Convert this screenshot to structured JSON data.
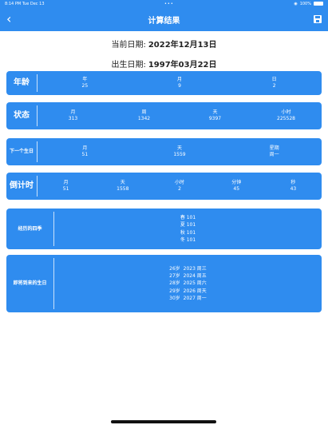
{
  "status_bar": {
    "time": "8:14 PM",
    "date": "Tue Dec 13",
    "dots": "•••",
    "wifi": "◉",
    "battery_pct": "100%"
  },
  "nav": {
    "title": "计算结果",
    "back_icon": "‹"
  },
  "current_date": {
    "label": "当前日期:",
    "value": "2022年12月13日"
  },
  "birth_date": {
    "label": "出生日期:",
    "value": "1997年03月22日"
  },
  "age": {
    "label": "年龄",
    "cols": [
      {
        "h": "年",
        "v": "25"
      },
      {
        "h": "月",
        "v": "9"
      },
      {
        "h": "日",
        "v": "2"
      }
    ]
  },
  "status": {
    "label": "状态",
    "cols": [
      {
        "h": "月",
        "v": "313"
      },
      {
        "h": "周",
        "v": "1342"
      },
      {
        "h": "天",
        "v": "9397"
      },
      {
        "h": "小时",
        "v": "225528"
      }
    ]
  },
  "next_birthday": {
    "label_1": "下一个",
    "label_2": "生日",
    "cols": [
      {
        "h": "月",
        "v": "51"
      },
      {
        "h": "天",
        "v": "1559"
      },
      {
        "h": "星期",
        "v": "周一"
      }
    ]
  },
  "countdown": {
    "label": "倒计时",
    "cols": [
      {
        "h": "月",
        "v": "51"
      },
      {
        "h": "天",
        "v": "1558"
      },
      {
        "h": "小时",
        "v": "2"
      },
      {
        "h": "分钟",
        "v": "45"
      },
      {
        "h": "秒",
        "v": "43"
      }
    ]
  },
  "seasons": {
    "label": "经历的四季",
    "items": [
      "春 101",
      "夏 101",
      "秋 101",
      "冬 101"
    ]
  },
  "upcoming": {
    "label_1": "即将到来",
    "label_2": "的生日",
    "items": [
      "26岁  2023 周三",
      "27岁  2024 周五",
      "28岁  2025 周六",
      "29岁  2026 周天",
      "30岁  2027 周一"
    ]
  }
}
